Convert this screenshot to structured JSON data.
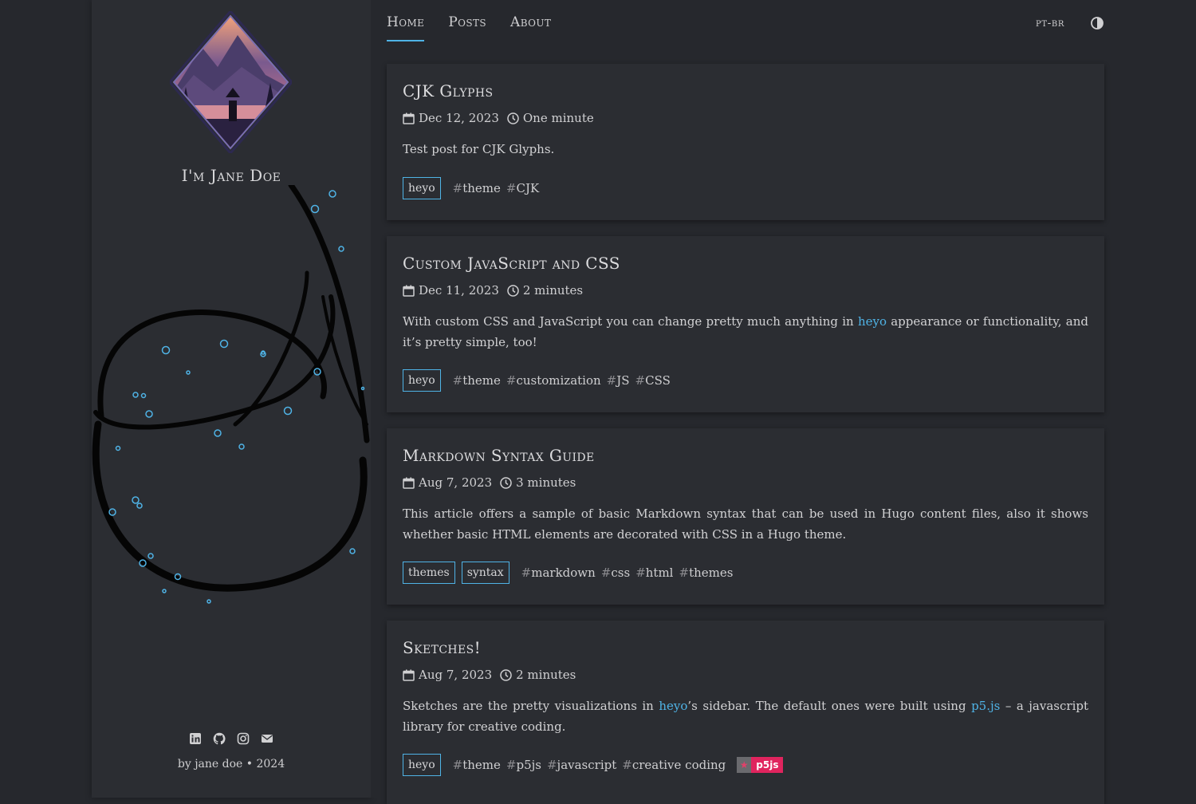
{
  "sidebar": {
    "title": "I'm Jane Doe",
    "footer": "by jane doe • 2024",
    "socials": [
      "linkedin-icon",
      "github-icon",
      "instagram-icon",
      "email-icon"
    ]
  },
  "nav": {
    "links": [
      "Home",
      "Posts",
      "About"
    ],
    "active": "Home",
    "language": "pt-br"
  },
  "colors": {
    "accent": "#4fb3e6",
    "background": "#26282d",
    "card": "#2b2d32"
  },
  "posts": [
    {
      "title": "CJK Glyphs",
      "date": "Dec 12, 2023",
      "reading_time": "One minute",
      "summary": "Test post for CJK Glyphs.",
      "categories": [
        "heyo"
      ],
      "tags": [
        "theme",
        "CJK"
      ]
    },
    {
      "title": "Custom JavaScript and CSS",
      "date": "Dec 11, 2023",
      "reading_time": "2 minutes",
      "summary_parts": [
        "With custom CSS and JavaScript you can change pretty much anything in ",
        "heyo",
        " appearance or functionality, and it’s pretty simple, too!"
      ],
      "categories": [
        "heyo"
      ],
      "tags": [
        "theme",
        "customization",
        "JS",
        "CSS"
      ]
    },
    {
      "title": "Markdown Syntax Guide",
      "date": "Aug 7, 2023",
      "reading_time": "3 minutes",
      "summary": "This article offers a sample of basic Markdown syntax that can be used in Hugo content files, also it shows whether basic HTML elements are decorated with CSS in a Hugo theme.",
      "categories": [
        "themes",
        "syntax"
      ],
      "tags": [
        "markdown",
        "css",
        "html",
        "themes"
      ]
    },
    {
      "title": "Sketches!",
      "date": "Aug 7, 2023",
      "reading_time": "2 minutes",
      "summary_parts": [
        "Sketches are the pretty visualizations in ",
        "heyo",
        "’s sidebar. The default ones were built using ",
        "p5.js",
        " – a javascript library for creative coding."
      ],
      "categories": [
        "heyo"
      ],
      "tags": [
        "theme",
        "p5js",
        "javascript",
        "creative coding"
      ],
      "badge": {
        "icon": "★",
        "label": "p5js"
      }
    }
  ]
}
